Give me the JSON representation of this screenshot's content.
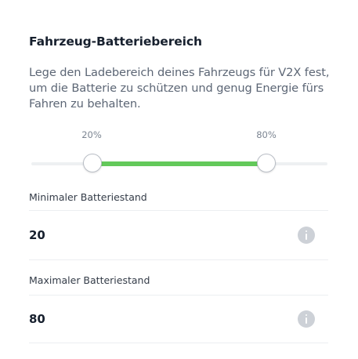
{
  "header": {
    "title": "Fahrzeug-Batteriebereich",
    "description": "Lege den Ladebereich deines Fahrzeugs für V2X fest, um die Batterie zu schützen und genug Energie fürs Fahren zu behalten."
  },
  "range": {
    "min_label": "20%",
    "max_label": "80%",
    "min_value": 20,
    "max_value": 80
  },
  "fields": {
    "min": {
      "label": "Minimaler Batteriestand",
      "value": "20",
      "icon": "info-icon"
    },
    "max": {
      "label": "Maximaler Batteriestand",
      "value": "80",
      "icon": "info-icon"
    }
  },
  "colors": {
    "accent": "#63c95a",
    "track": "#eef0f2",
    "info_icon": "#cdd1d7"
  }
}
